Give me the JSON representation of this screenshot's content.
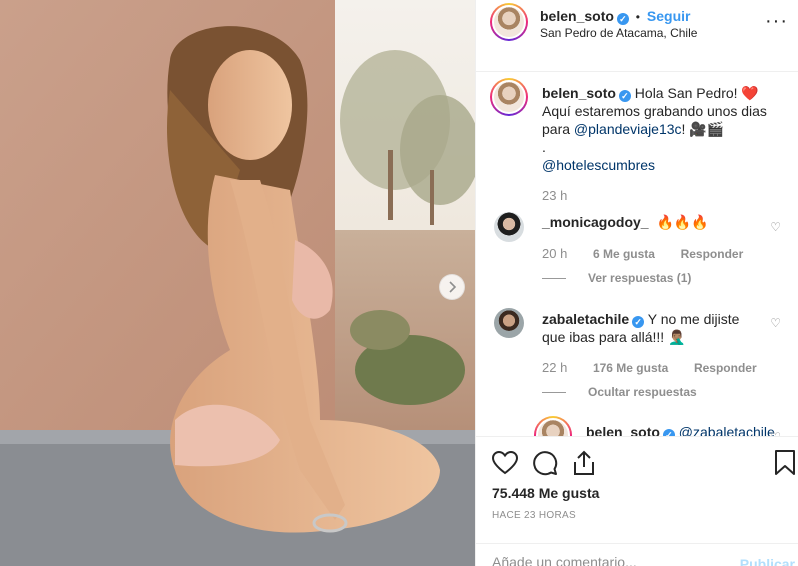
{
  "post": {
    "username": "belen_soto",
    "follow_label": "Seguir",
    "dot": "•",
    "location": "San Pedro de Atacama, Chile",
    "more": "···"
  },
  "caption": {
    "username": "belen_soto",
    "line1": "Hola San Pedro! ❤️",
    "line2": "Aquí estaremos grabando unos dias",
    "line3_prefix": "para ",
    "mention": "@plandeviaje13c",
    "line3_suffix": "! 🎥🎬",
    "dot": ".",
    "mention2": "@hotelescumbres",
    "time": "23 h"
  },
  "comments": [
    {
      "username": "_monicagodoy_",
      "text": "🔥🔥🔥",
      "time": "20 h",
      "likes": "6 Me gusta",
      "reply": "Responder",
      "replies_toggle": "Ver respuestas (1)"
    },
    {
      "username": "zabaletachile",
      "text_line1": "Y no me dijiste",
      "text_line2": "que ibas para allá!!! 🤦🏽‍♂️",
      "time": "22 h",
      "likes": "176 Me gusta",
      "reply": "Responder",
      "replies_toggle": "Ocultar respuestas"
    }
  ],
  "nested_reply": {
    "username": "belen_soto",
    "mention": "@zabaletachile"
  },
  "footer": {
    "likes": "75.448 Me gusta",
    "time": "HACE 23 HORAS",
    "comment_placeholder": "Añade un comentario...",
    "publish": "Publicar"
  },
  "icons": {
    "heart": "heart-icon",
    "comment": "comment-icon",
    "share": "share-icon",
    "save": "bookmark-icon",
    "next": "chevron-right-icon",
    "verified": "verified-badge-icon"
  },
  "colors": {
    "link": "#3897f0",
    "verified": "#3897f0",
    "muted": "#8e8e8e",
    "publish_disabled": "#b2dffc"
  }
}
